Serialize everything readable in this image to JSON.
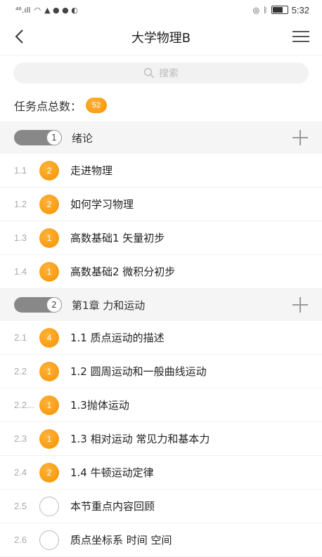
{
  "status_bar": {
    "signal": "⁴⁶.ıll",
    "icons": [
      "wifi-icon",
      "chat-icon",
      "nfc-icon",
      "bluetooth-icon",
      "mute-icon",
      "battery-icon"
    ],
    "time": "5:32"
  },
  "header": {
    "title": "大学物理B"
  },
  "search": {
    "placeholder": "搜索"
  },
  "task_total": {
    "label": "任务点总数：",
    "count": "52"
  },
  "sections": [
    {
      "index": "1",
      "title": "绪论",
      "items": [
        {
          "num": "1.1",
          "badge": "2",
          "label": "走进物理"
        },
        {
          "num": "1.2",
          "badge": "2",
          "label": "如何学习物理"
        },
        {
          "num": "1.3",
          "badge": "1",
          "label": "高数基础1 矢量初步"
        },
        {
          "num": "1.4",
          "badge": "1",
          "label": "高数基础2 微积分初步"
        }
      ]
    },
    {
      "index": "2",
      "title": "第1章  力和运动",
      "items": [
        {
          "num": "2.1",
          "badge": "4",
          "label": "1.1  质点运动的描述"
        },
        {
          "num": "2.2",
          "badge": "1",
          "label": "1.2  圆周运动和一般曲线运动"
        },
        {
          "num": "2.2...",
          "badge": "1",
          "label": "1.3抛体运动"
        },
        {
          "num": "2.3",
          "badge": "1",
          "label": "1.3  相对运动  常见力和基本力"
        },
        {
          "num": "2.4",
          "badge": "2",
          "label": "1.4 牛顿运动定律"
        },
        {
          "num": "2.5",
          "badge": "",
          "label": "本节重点内容回顾"
        },
        {
          "num": "2.6",
          "badge": "",
          "label": "质点坐标系 时间 空间"
        }
      ]
    }
  ],
  "colors": {
    "badge": "#f59300",
    "section_bg": "#f5f5f5",
    "toggle": "#888888"
  }
}
